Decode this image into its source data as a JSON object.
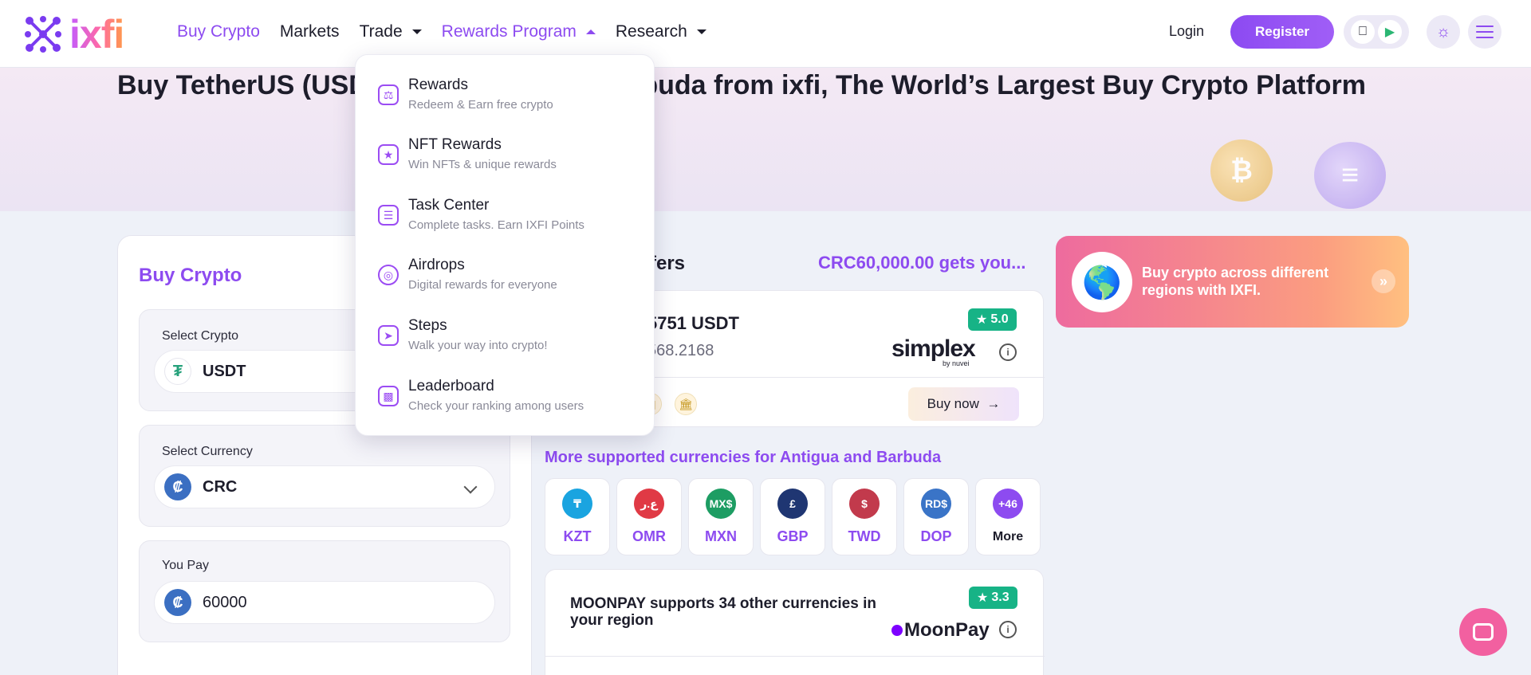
{
  "header": {
    "logo_text": "ixfi",
    "nav": [
      {
        "label": "Buy Crypto"
      },
      {
        "label": "Markets"
      },
      {
        "label": "Trade"
      },
      {
        "label": "Rewards Program"
      },
      {
        "label": "Research"
      }
    ],
    "login_label": "Login",
    "register_label": "Register"
  },
  "hero": {
    "title": "Buy TetherUS (USDT) in Antigua and Barbuda from ixfi, The World’s Largest Buy Crypto Platform"
  },
  "form": {
    "title": "Buy Crypto",
    "crypto_label": "Select Crypto",
    "crypto_value": "USDT",
    "currency_label": "Select Currency",
    "currency_value": "CRC",
    "pay_label": "You Pay",
    "pay_value": "60000"
  },
  "offers": {
    "title": "Offers",
    "header_right": "CRC60,000.00 gets you...",
    "best": {
      "amount": "5751 USDT",
      "sub": "568.2168",
      "rating": "5.0",
      "provider": "simplex",
      "provider_sub": "by nuvei",
      "buy_label": "Buy now"
    }
  },
  "more_currencies": {
    "title": "More supported currencies for Antigua and Barbuda",
    "items": [
      {
        "code": "KZT",
        "symbol": "₸",
        "color": "#1aa4e0"
      },
      {
        "code": "OMR",
        "symbol": "ع.ر",
        "color": "#e03a45"
      },
      {
        "code": "MXN",
        "symbol": "MX$",
        "color": "#1d9d63"
      },
      {
        "code": "GBP",
        "symbol": "£",
        "color": "#1f3672"
      },
      {
        "code": "TWD",
        "symbol": "$",
        "color": "#c23a4c"
      },
      {
        "code": "DOP",
        "symbol": "RD$",
        "color": "#3a74c7"
      }
    ],
    "more_count": "+46",
    "more_label": "More"
  },
  "moonpay": {
    "text": "MOONPAY supports 34 other currencies in your region",
    "rating": "3.3",
    "provider": "MoonPay"
  },
  "promo": {
    "text": "Buy crypto across different regions with IXFI."
  },
  "dropdown": {
    "items": [
      {
        "title": "Rewards",
        "sub": "Redeem & Earn free crypto",
        "icon": "trophy-icon"
      },
      {
        "title": "NFT Rewards",
        "sub": "Win NFTs & unique rewards",
        "icon": "nft-trophy-icon"
      },
      {
        "title": "Task Center",
        "sub": "Complete tasks. Earn IXFI Points",
        "icon": "task-list-icon"
      },
      {
        "title": "Airdrops",
        "sub": "Digital rewards for everyone",
        "icon": "airdrop-icon"
      },
      {
        "title": "Steps",
        "sub": "Walk your way into crypto!",
        "icon": "walking-icon"
      },
      {
        "title": "Leaderboard",
        "sub": "Check your ranking among users",
        "icon": "leaderboard-icon"
      }
    ]
  },
  "colors": {
    "accent": "#8d4bf0",
    "rating_green": "#17b386",
    "chat_pink": "#f260a0"
  }
}
